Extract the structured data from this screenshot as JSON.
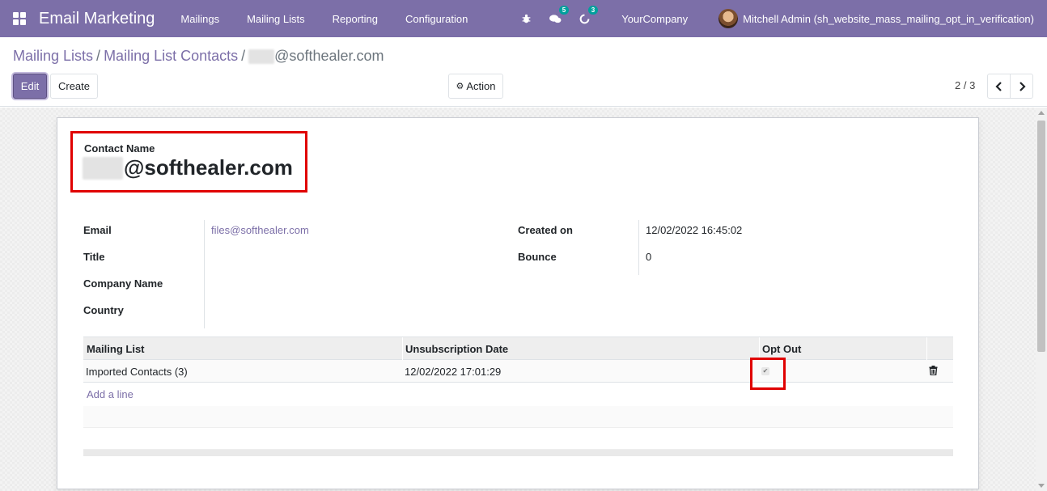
{
  "navbar": {
    "app_title": "Email Marketing",
    "menu": [
      "Mailings",
      "Mailing Lists",
      "Reporting",
      "Configuration"
    ],
    "bug_icon": "bug-icon",
    "messages_count": "5",
    "activities_count": "3",
    "company": "YourCompany",
    "user": "Mitchell Admin (sh_website_mass_mailing_opt_in_verification)",
    "bg_color": "#7c6fa8"
  },
  "breadcrumb": {
    "items": [
      "Mailing Lists",
      "Mailing List Contacts"
    ],
    "current_suffix": "@softhealer.com"
  },
  "buttons": {
    "edit": "Edit",
    "create": "Create",
    "action": "Action"
  },
  "pager": {
    "value": "2 / 3"
  },
  "record": {
    "contact_name_label": "Contact Name",
    "contact_name_suffix": "@softhealer.com",
    "fields_left": [
      {
        "label": "Email",
        "value": "files@softhealer.com"
      },
      {
        "label": "Title",
        "value": ""
      },
      {
        "label": "Company Name",
        "value": ""
      },
      {
        "label": "Country",
        "value": ""
      }
    ],
    "fields_right": [
      {
        "label": "Created on",
        "value": "12/02/2022 16:45:02"
      },
      {
        "label": "Bounce",
        "value": "0"
      }
    ]
  },
  "subscriptions": {
    "columns": [
      "Mailing List",
      "Unsubscription Date",
      "Opt Out"
    ],
    "rows": [
      {
        "mailing_list": "Imported Contacts (3)",
        "unsubscription_date": "12/02/2022 17:01:29",
        "opt_out": true
      }
    ],
    "add_line": "Add a line"
  },
  "highlight_color": "#e00000"
}
